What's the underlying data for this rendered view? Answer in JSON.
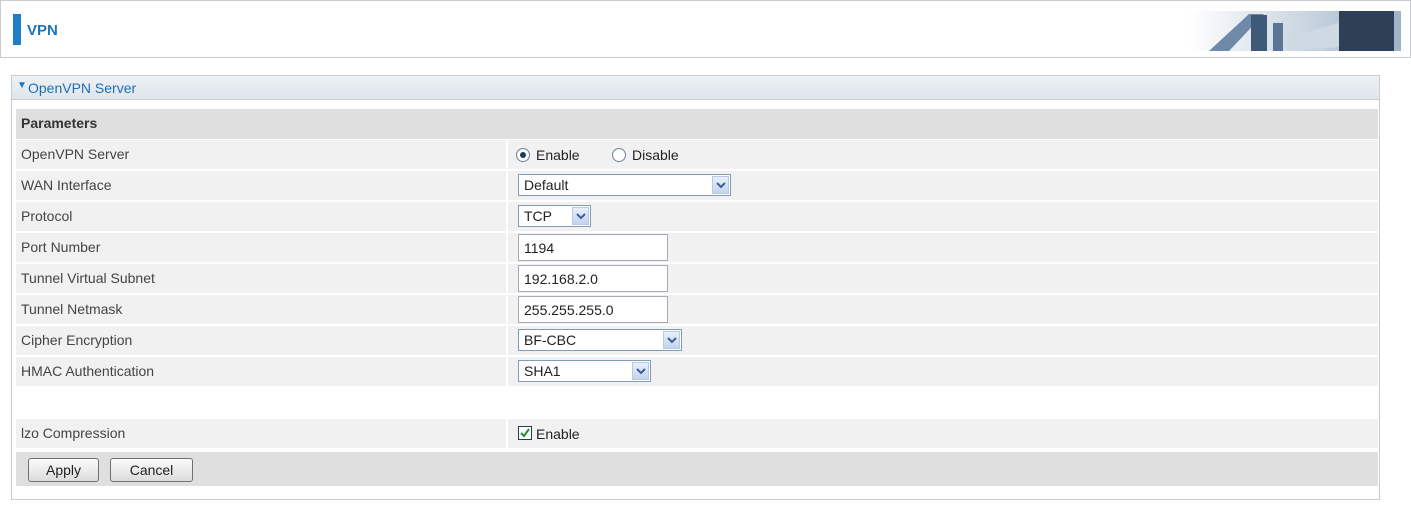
{
  "header": {
    "title": "VPN"
  },
  "panel": {
    "title": "OpenVPN Server",
    "section_label": "Parameters"
  },
  "fields": {
    "openvpn_server": {
      "label": "OpenVPN Server",
      "enable_label": "Enable",
      "disable_label": "Disable",
      "selected": "Enable"
    },
    "wan_interface": {
      "label": "WAN Interface",
      "value": "Default"
    },
    "protocol": {
      "label": "Protocol",
      "value": "TCP"
    },
    "port_number": {
      "label": "Port Number",
      "value": "1194"
    },
    "tunnel_virtual_subnet": {
      "label": "Tunnel Virtual Subnet",
      "value": "192.168.2.0"
    },
    "tunnel_netmask": {
      "label": "Tunnel Netmask",
      "value": "255.255.255.0"
    },
    "cipher_encryption": {
      "label": "Cipher Encryption",
      "value": "BF-CBC"
    },
    "hmac_authentication": {
      "label": "HMAC Authentication",
      "value": "SHA1"
    },
    "lzo_compression": {
      "label": "lzo Compression",
      "enable_label": "Enable",
      "checked": true
    }
  },
  "buttons": {
    "apply": "Apply",
    "cancel": "Cancel"
  },
  "colors": {
    "accent": "#1f7fc6",
    "title_text": "#1f73b8",
    "row_bg": "#f1f1f1",
    "section_bg": "#dfdfdf"
  }
}
